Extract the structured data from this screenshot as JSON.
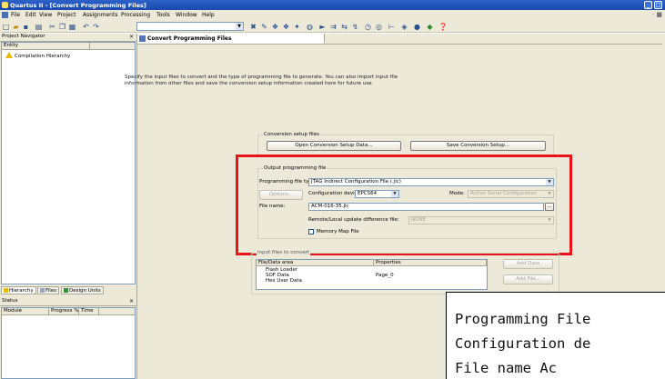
{
  "window": {
    "title": "Quartus II - [Convert Programming Files]",
    "minimize": "_",
    "restore": "□"
  },
  "menubar": {
    "items": [
      "File",
      "Edit",
      "View",
      "Project",
      "Assignments",
      "Processing",
      "Tools",
      "Window",
      "Help"
    ],
    "mdi_controls": "- ■"
  },
  "toolbar": {
    "icons": [
      "new-icon",
      "open-icon",
      "save-icon",
      "print-icon",
      "cut-icon",
      "copy-icon",
      "paste-icon",
      "undo-icon",
      "redo-icon",
      "compile-icon",
      "analyze-icon",
      "start-icon",
      "stop-icon",
      "settings-icon",
      "chip-planner-icon",
      "programmer-icon",
      "help-icon"
    ]
  },
  "project_navigator": {
    "title": "Project Navigator",
    "close": "×",
    "entity_column": "Entity",
    "hierarchy_item": "Compilation Hierarchy",
    "tabs": [
      "Hierarchy",
      "Files",
      "Design Units"
    ]
  },
  "status_panel": {
    "title": "Status",
    "close": "×",
    "columns": [
      "Module",
      "Progress %",
      "Time"
    ]
  },
  "document_tab": {
    "label": "Convert Programming Files"
  },
  "intro_text": "Specify the input files to convert and the type of programming file to generate. You can also import input file information from other files and save the conversion setup information created here for future use.",
  "conversion_setup": {
    "legend": "Conversion setup files",
    "open_button": "Open Conversion Setup Data...",
    "save_button": "Save Conversion Setup..."
  },
  "output_file": {
    "legend": "Output programming file",
    "file_type_label": "Programming file type:",
    "file_type_value": "JTAG Indirect Configuration File (.jic)",
    "options_button": "Options...",
    "config_device_label": "Configuration device:",
    "config_device_value": "EPCS64",
    "mode_label": "Mode:",
    "mode_value": "Active Serial Configuration",
    "file_name_label": "File name:",
    "file_name_value": "ACM-016-35.jic",
    "browse": "...",
    "remote_label": "Remote/Local update difference file:",
    "remote_value": "NONE",
    "memory_map_label": "Memory Map File",
    "memory_map_checked": false
  },
  "input_files": {
    "legend": "Input files to convert",
    "columns": [
      "File/Data area",
      "Properties"
    ],
    "rows": [
      {
        "area": "Flash Loader",
        "props": ""
      },
      {
        "area": "SOF Data",
        "props": "Page_0"
      },
      {
        "area": "Hex User Data",
        "props": ""
      }
    ],
    "add_data_button": "Add Data",
    "add_file_button": "Add File..."
  },
  "callout": {
    "lines": [
      "Programming File",
      "Configuration de",
      "File name    Ac"
    ]
  },
  "colors": {
    "highlight": "#e8141b",
    "title_bar": "#1b48ad"
  }
}
